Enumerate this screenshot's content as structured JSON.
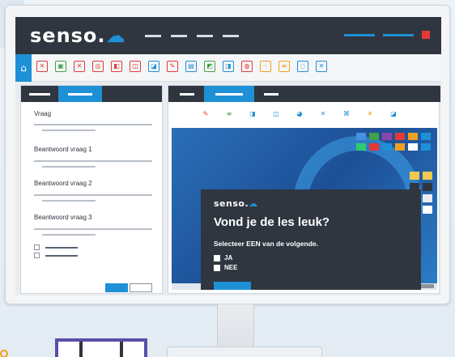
{
  "app": {
    "logo_text": "senso.",
    "brand_color": "#1e90d6",
    "dark_color": "#2f3640",
    "close_color": "#e53935"
  },
  "toolbar": {
    "home_icon": "home-icon",
    "icons": [
      {
        "name": "tool-icon-1",
        "glyph": "✕",
        "color": "#e53935"
      },
      {
        "name": "tool-icon-2",
        "glyph": "▣",
        "color": "#43a047"
      },
      {
        "name": "tool-icon-3",
        "glyph": "✕",
        "color": "#e53935"
      },
      {
        "name": "tool-icon-4",
        "glyph": "◎",
        "color": "#e53935"
      },
      {
        "name": "tool-icon-5",
        "glyph": "◧",
        "color": "#e53935"
      },
      {
        "name": "tool-icon-6",
        "glyph": "◫",
        "color": "#e53935"
      },
      {
        "name": "tool-icon-7",
        "glyph": "◪",
        "color": "#1e90d6"
      },
      {
        "name": "tool-icon-8",
        "glyph": "✎",
        "color": "#e53935"
      },
      {
        "name": "tool-icon-9",
        "glyph": "▤",
        "color": "#1e90d6"
      },
      {
        "name": "tool-icon-10",
        "glyph": "◩",
        "color": "#43a047"
      },
      {
        "name": "tool-icon-11",
        "glyph": "◨",
        "color": "#1e90d6"
      },
      {
        "name": "tool-icon-12",
        "glyph": "◍",
        "color": "#e53935"
      },
      {
        "name": "tool-icon-13",
        "glyph": "◦",
        "color": "#f2a01e"
      },
      {
        "name": "tool-icon-14",
        "glyph": "≡",
        "color": "#f2a01e"
      },
      {
        "name": "tool-icon-15",
        "glyph": "◌",
        "color": "#1e90d6"
      },
      {
        "name": "tool-icon-16",
        "glyph": "✕",
        "color": "#1e90d6"
      }
    ]
  },
  "left_panel": {
    "question_label": "Vraag",
    "answer1_label": "Beantwoord vraag 1",
    "answer2_label": "Beantwoord vraag 2",
    "answer3_label": "Beantwoord vraag 3"
  },
  "right_panel": {
    "icons": [
      {
        "name": "rp-icon-1",
        "glyph": "✎",
        "color": "#e53935"
      },
      {
        "name": "rp-icon-2",
        "glyph": "≡",
        "color": "#43a047"
      },
      {
        "name": "rp-icon-3",
        "glyph": "◨",
        "color": "#1e90d6"
      },
      {
        "name": "rp-icon-4",
        "glyph": "◫",
        "color": "#1e90d6"
      },
      {
        "name": "rp-icon-5",
        "glyph": "◕",
        "color": "#1e90d6"
      },
      {
        "name": "rp-icon-6",
        "glyph": "✕",
        "color": "#1e90d6"
      },
      {
        "name": "rp-icon-7",
        "glyph": "⌘",
        "color": "#1e90d6"
      },
      {
        "name": "rp-icon-8",
        "glyph": "✕",
        "color": "#f2a01e"
      },
      {
        "name": "rp-icon-9",
        "glyph": "◪",
        "color": "#1e90d6"
      }
    ]
  },
  "poll": {
    "logo_text": "senso.",
    "title": "Vond je de les leuk?",
    "subtitle": "Selecteer EEN van de volgende.",
    "option_yes": "JA",
    "option_no": "NEE"
  }
}
